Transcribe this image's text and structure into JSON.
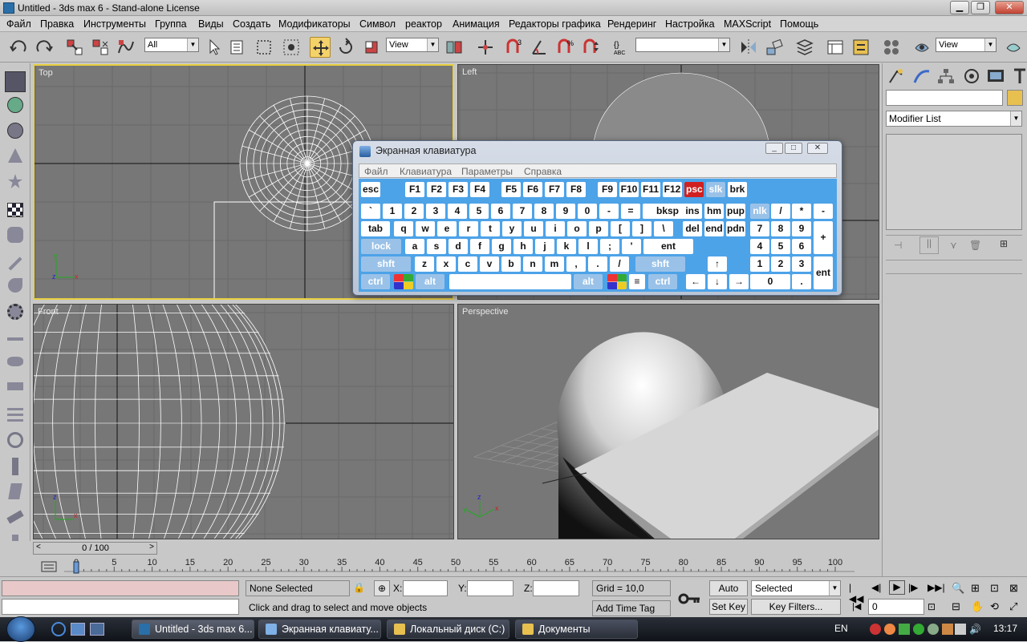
{
  "window": {
    "title": "Untitled - 3ds max 6 - Stand-alone License",
    "min": "▁",
    "max": "❐",
    "close": "✕"
  },
  "menu": [
    "Файл",
    "Правка",
    "Инструменты",
    "Группа",
    "Виды",
    "Создать",
    "Модификаторы",
    "Символ",
    "реактор",
    "Анимация",
    "Редакторы графика",
    "Рендеринг",
    "Настройка",
    "MAXScript",
    "Помощь"
  ],
  "toolbar": {
    "selection_filter": "All",
    "ref_coord": "View",
    "named_sel": "",
    "render_view": "View"
  },
  "viewports": {
    "top": "Top",
    "left": "Left",
    "front": "Front",
    "perspective": "Perspective"
  },
  "command_panel": {
    "name_field": "",
    "modifier_list": "Modifier List"
  },
  "osk": {
    "title": "Экранная клавиатура",
    "menu": [
      "Файл",
      "Клавиатура",
      "Параметры",
      "Справка"
    ],
    "rows": {
      "fn": [
        "esc",
        "F1",
        "F2",
        "F3",
        "F4",
        "F5",
        "F6",
        "F7",
        "F8",
        "F9",
        "F10",
        "F11",
        "F12",
        "psc",
        "slk",
        "brk"
      ],
      "num": [
        "`",
        "1",
        "2",
        "3",
        "4",
        "5",
        "6",
        "7",
        "8",
        "9",
        "0",
        "-",
        "=",
        "bksp",
        "ins",
        "hm",
        "pup",
        "nlk",
        "/",
        "*",
        "-"
      ],
      "tab": [
        "tab",
        "q",
        "w",
        "e",
        "r",
        "t",
        "y",
        "u",
        "i",
        "o",
        "p",
        "[",
        "]",
        "\\",
        "del",
        "end",
        "pdn",
        "7",
        "8",
        "9",
        "+"
      ],
      "caps": [
        "lock",
        "a",
        "s",
        "d",
        "f",
        "g",
        "h",
        "j",
        "k",
        "l",
        ";",
        "'",
        "ent",
        "4",
        "5",
        "6"
      ],
      "shift": [
        "shft",
        "z",
        "x",
        "c",
        "v",
        "b",
        "n",
        "m",
        ",",
        ".",
        "/",
        "shft",
        "↑",
        "1",
        "2",
        "3"
      ],
      "ctrl": [
        "ctrl",
        "",
        "alt",
        "",
        "alt",
        "",
        "≡",
        "ctrl",
        "←",
        "↓",
        "→",
        "0",
        ".",
        "ent"
      ]
    }
  },
  "timeline": {
    "frame_label": "0 / 100",
    "ticks": [
      "0",
      "5",
      "10",
      "15",
      "20",
      "25",
      "30",
      "35",
      "40",
      "45",
      "50",
      "55",
      "60",
      "65",
      "70",
      "75",
      "80",
      "85",
      "90",
      "95",
      "100"
    ]
  },
  "status": {
    "selected": "None Selected",
    "prompt": "Click and drag to select and move objects",
    "x_label": "X:",
    "y_label": "Y:",
    "z_label": "Z:",
    "grid": "Grid = 10,0",
    "add_time_tag": "Add Time Tag",
    "auto_key": "Auto Key",
    "set_key": "Set Key",
    "key_mode": "Selected",
    "key_filters": "Key Filters...",
    "frame": "0"
  },
  "taskbar": {
    "items": [
      "Untitled - 3ds max 6...",
      "Экранная клавиату...",
      "Локальный диск (C:)",
      "Документы"
    ],
    "lang": "EN",
    "clock": "13:17"
  },
  "colors": {
    "viewport_bg": "#777777",
    "active_border": "#e8d040",
    "osk_keys_bg": "#4da3e8",
    "taskbar": "#1a1e26"
  }
}
